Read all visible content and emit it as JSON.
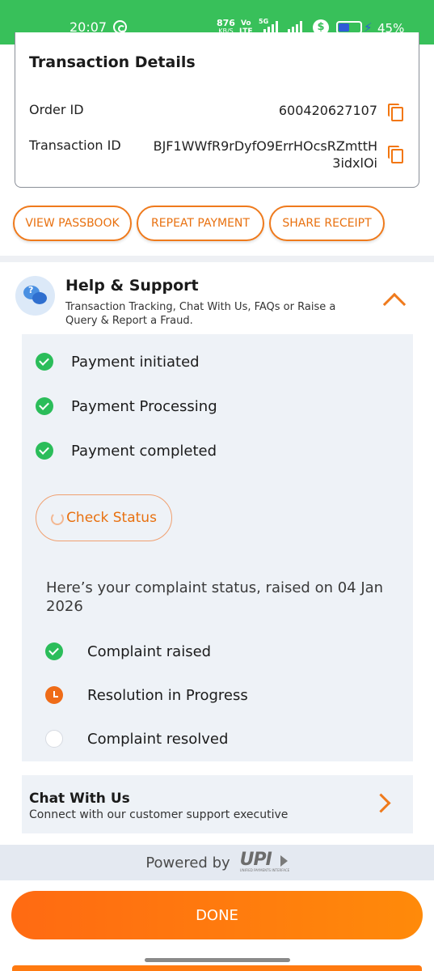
{
  "status_bar": {
    "time": "20:07",
    "net_speed": "876",
    "net_unit": "KB/S",
    "volte_top": "Vo",
    "volte_bottom": "LTE",
    "network": "5G",
    "battery": "45%"
  },
  "transaction": {
    "title": "Transaction Details",
    "order_id_label": "Order ID",
    "order_id": "600420627107",
    "txn_id_label": "Transaction ID",
    "txn_id_line1": "BJF1WWfR9rDyfO9ErrHOcsRZmttH",
    "txn_id_line2": "3idxlOi"
  },
  "actions": {
    "view_passbook": "VIEW PASSBOOK",
    "repeat_payment": "REPEAT PAYMENT",
    "share_receipt": "SHARE RECEIPT"
  },
  "help": {
    "title": "Help & Support",
    "subtitle": "Transaction Tracking, Chat With Us, FAQs or Raise a Query & Report a Fraud."
  },
  "payment_steps": [
    {
      "label": "Payment initiated",
      "state": "done"
    },
    {
      "label": "Payment Processing",
      "state": "done"
    },
    {
      "label": "Payment completed",
      "state": "done"
    }
  ],
  "check_status_label": "Check Status",
  "complaint": {
    "text": "Here’s your complaint status, raised on  04 Jan 2026",
    "steps": [
      {
        "label": "Complaint raised",
        "state": "done"
      },
      {
        "label": "Resolution in Progress",
        "state": "in-progress"
      },
      {
        "label": "Complaint resolved",
        "state": "pending"
      }
    ]
  },
  "chat": {
    "title": "Chat With Us",
    "subtitle": "Connect with our customer support executive"
  },
  "powered_by": {
    "text": "Powered by",
    "logo": "UPI",
    "logo_subtitle": "UNIFIED PAYMENTS INTERFACE"
  },
  "done_label": "DONE",
  "colors": {
    "status_bar": "#38c05a",
    "accent": "#ef7a1c",
    "success": "#2bbd5a",
    "panel": "#eef2f7"
  }
}
